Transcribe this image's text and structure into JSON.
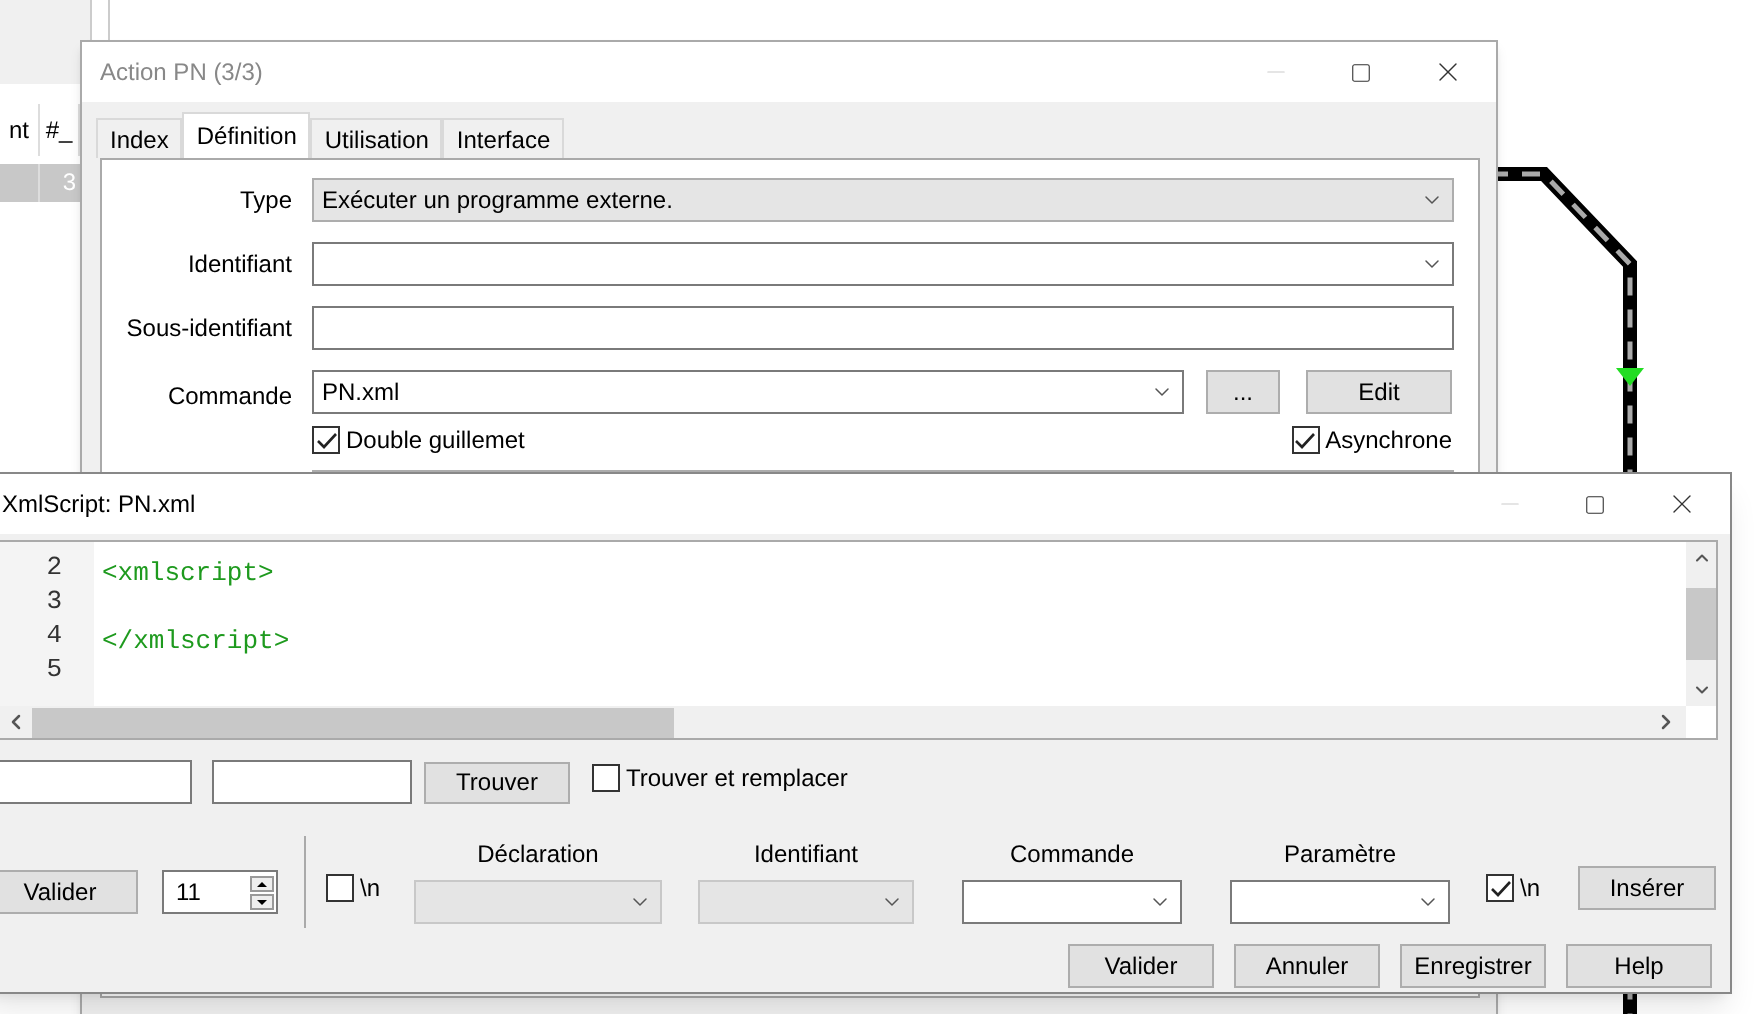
{
  "background_table": {
    "columns": [
      "nt",
      "#_"
    ],
    "rows": [
      {
        "cells": [
          "",
          "3"
        ],
        "selected": true
      }
    ]
  },
  "action_window": {
    "title": "Action PN (3/3)",
    "tabs": [
      {
        "label": "Index",
        "selected": false
      },
      {
        "label": "Définition",
        "selected": true
      },
      {
        "label": "Utilisation",
        "selected": false
      },
      {
        "label": "Interface",
        "selected": false
      }
    ],
    "fields": [
      {
        "kind": "select",
        "label": "Type",
        "value": "Exécuter un programme externe."
      },
      {
        "kind": "combo",
        "label": "Identifiant"
      },
      {
        "kind": "text",
        "label": "Sous-identifiant"
      },
      {
        "kind": "command",
        "label": "Commande",
        "value": "PN.xml",
        "buttons": [
          "...",
          "Edit"
        ]
      }
    ],
    "options": [
      {
        "label": "Double guillemet",
        "checked": true
      },
      {
        "label": "Asynchrone",
        "checked": true
      }
    ]
  },
  "editor_window": {
    "title": "XmlScript: PN.xml",
    "lines": [
      {
        "number": "2",
        "code": "<xmlscript>"
      },
      {
        "number": "3"
      },
      {
        "number": "4",
        "code": "</xmlscript>"
      },
      {
        "number": "5"
      }
    ],
    "find_button": "Trouver",
    "replace_option": {
      "label": "Trouver et remplacer",
      "checked": false
    },
    "goto_button": "Valider",
    "font_size": "11",
    "newline_left": {
      "label": "\\n",
      "checked": false
    },
    "selectors": [
      {
        "label": "Déclaration",
        "disabled": true
      },
      {
        "label": "Identifiant",
        "disabled": true
      },
      {
        "label": "Commande",
        "disabled": false
      },
      {
        "label": "Paramètre",
        "disabled": false
      }
    ],
    "newline_right": {
      "label": "\\n",
      "checked": true
    },
    "insert_button": "Insérer",
    "footer_buttons": [
      "Valider",
      "Annuler",
      "Enregistrer",
      "Help"
    ]
  }
}
